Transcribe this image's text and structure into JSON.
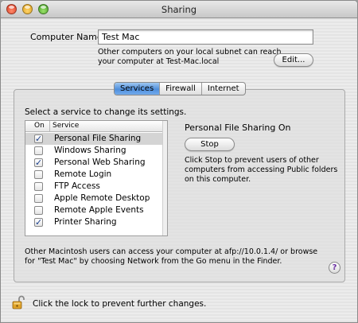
{
  "window": {
    "title": "Sharing"
  },
  "computer": {
    "label": "Computer Name:",
    "value": "Test Mac",
    "note": "Other computers on your local subnet can reach your computer at Test-Mac.local",
    "edit_label": "Edit..."
  },
  "tabs": [
    {
      "label": "Services",
      "active": true
    },
    {
      "label": "Firewall",
      "active": false
    },
    {
      "label": "Internet",
      "active": false
    }
  ],
  "services": {
    "hint": "Select a service to change its settings.",
    "col_on": "On",
    "col_service": "Service",
    "items": [
      {
        "label": "Personal File Sharing",
        "on": true,
        "check": "✓"
      },
      {
        "label": "Windows Sharing",
        "on": false,
        "check": ""
      },
      {
        "label": "Personal Web Sharing",
        "on": true,
        "check": "✓"
      },
      {
        "label": "Remote Login",
        "on": false,
        "check": ""
      },
      {
        "label": "FTP Access",
        "on": false,
        "check": ""
      },
      {
        "label": "Apple Remote Desktop",
        "on": false,
        "check": ""
      },
      {
        "label": "Remote Apple Events",
        "on": false,
        "check": ""
      },
      {
        "label": "Printer Sharing",
        "on": true,
        "check": "✓"
      }
    ],
    "selected_index": 0
  },
  "detail": {
    "status": "Personal File Sharing On",
    "stop_label": "Stop",
    "note": "Click Stop to prevent users of other computers from accessing Public folders on this computer."
  },
  "access_note": "Other Macintosh users can access your computer at afp://10.0.1.4/ or browse for \"Test Mac\" by choosing Network from the Go menu in the Finder.",
  "help_label": "?",
  "lock": {
    "note": "Click the lock to prevent further changes.",
    "icon": "open-lock-icon"
  },
  "colors": {
    "tab_active": "#5b9ae0",
    "check": "#1a3f8c",
    "lock_body": "#d99a1e"
  }
}
